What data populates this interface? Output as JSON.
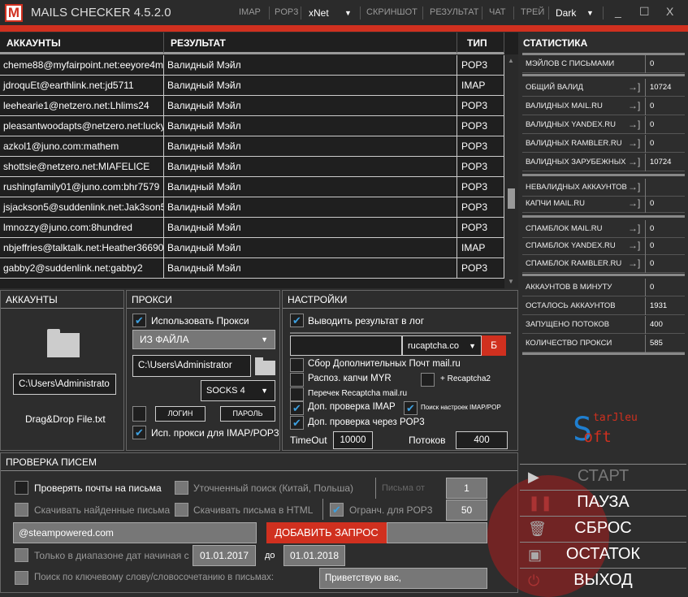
{
  "window": {
    "logo": "M",
    "title": "MAILS CHECKER 4.5.2.0",
    "menu": [
      "IMAP",
      "POP3",
      "xNet",
      "СКРИНШОТ",
      "РЕЗУЛЬТАТ",
      "ЧАТ",
      "ТРЕЙ",
      "Dark"
    ],
    "minimize": "_",
    "maximize": "☐",
    "close": "X"
  },
  "table": {
    "headers": [
      "АККАУНТЫ",
      "РЕЗУЛЬТАТ",
      "ТИП"
    ],
    "rows": [
      [
        "cheme88@myfairpoint.net:eeyore4m",
        "Валидный Мэйл",
        "POP3"
      ],
      [
        "jdroquEt@earthlink.net:jd5711",
        "Валидный Мэйл",
        "IMAP"
      ],
      [
        "leehearie1@netzero.net:Lhlims24",
        "Валидный Мэйл",
        "POP3"
      ],
      [
        "pleasantwoodapts@netzero.net:lucky",
        "Валидный Мэйл",
        "POP3"
      ],
      [
        "azkol1@juno.com:mathem",
        "Валидный Мэйл",
        "POP3"
      ],
      [
        "shottsie@netzero.net:MIAFELICE",
        "Валидный Мэйл",
        "POP3"
      ],
      [
        "rushingfamily01@juno.com:bhr7579",
        "Валидный Мэйл",
        "POP3"
      ],
      [
        "jsjackson5@suddenlink.net:Jak3son5",
        "Валидный Мэйл",
        "POP3"
      ],
      [
        "lmnozzy@juno.com:8hundred",
        "Валидный Мэйл",
        "POP3"
      ],
      [
        "nbjeffries@talktalk.net:Heather36690",
        "Валидный Мэйл",
        "IMAP"
      ],
      [
        "gabby2@suddenlink.net:gabby2",
        "Валидный Мэйл",
        "POP3"
      ]
    ]
  },
  "stats": {
    "title": "СТАТИСТИКА",
    "items": [
      {
        "label": "МЭЙЛОВ С ПИСЬМАМИ",
        "value": "0"
      },
      {
        "label": "ОБЩИЙ ВАЛИД",
        "value": "10724"
      },
      {
        "label": "ВАЛИДНЫХ MAIL.RU",
        "value": "0"
      },
      {
        "label": "ВАЛИДНЫХ YANDEX.RU",
        "value": "0"
      },
      {
        "label": "ВАЛИДНЫХ RAMBLER.RU",
        "value": "0"
      },
      {
        "label": "ВАЛИДНЫХ ЗАРУБЕЖНЫХ",
        "value": "10724"
      },
      {
        "label": "НЕВАЛИДНЫХ АККАУНТОВ",
        "value": ""
      },
      {
        "label": "КАПЧИ MAIL.RU",
        "value": "0"
      },
      {
        "label": "СПАМБЛОК MAIL.RU",
        "value": "0"
      },
      {
        "label": "СПАМБЛОК YANDEX.RU",
        "value": "0"
      },
      {
        "label": "СПАМБЛОК RAMBLER.RU",
        "value": "0"
      },
      {
        "label": "АККАУНТОВ В МИНУТУ",
        "value": "0"
      },
      {
        "label": "ОСТАЛОСЬ АККАУНТОВ",
        "value": "1931"
      },
      {
        "label": "ЗАПУЩЕНО ПОТОКОВ",
        "value": "400"
      },
      {
        "label": "КОЛИЧЕСТВО ПРОКСИ",
        "value": "585"
      }
    ]
  },
  "accounts": {
    "title": "АККАУНТЫ",
    "path": "C:\\Users\\Administrato",
    "file": "Drag&Drop File.txt"
  },
  "proxy": {
    "title": "ПРОКСИ",
    "use_proxy": "Использовать Прокси",
    "source": "ИЗ ФАЙЛА",
    "path": "C:\\Users\\Administrator",
    "type": "SOCKS 4",
    "login": "ЛОГИН",
    "password": "ПАРОЛЬ",
    "imap_pop3": "Исп. прокси для IMAP/POP3"
  },
  "settings": {
    "title": "НАСТРОЙКИ",
    "log": "Выводить результат в лог",
    "captcha_service": "rucaptcha.co",
    "captcha_btn": "Б",
    "collect": "Сбор Дополнительных Почт mail.ru",
    "myr": "Распоз. капчи MYR",
    "recaptcha2": "+ Recaptcha2",
    "recheck": "Перечек Recaptcha mail.ru",
    "imap_check": "Доп. проверка IMAP",
    "imap_search": "Поиск настроек IMAP/POP",
    "pop3_check": "Доп. проверка через POP3",
    "timeout_label": "TimeOut",
    "timeout": "10000",
    "threads_label": "Потоков",
    "threads": "400"
  },
  "mailcheck": {
    "title": "ПРОВЕРКА ПИСЕМ",
    "check": "Проверять почты на письма",
    "refined": "Уточненный поиск (Китай, Польша)",
    "letters_from": "Письма от",
    "from_val": "1",
    "download": "Скачивать найденные письма",
    "html": "Скачивать письма в HTML",
    "limit": "Огранч. для POP3",
    "limit_val": "50",
    "query": "@steampowered.com",
    "add_query": "ДОБАВИТЬ ЗАПРОС",
    "date_range": "Только в диапазоне дат начиная с",
    "date_from": "01.01.2017",
    "to": "до",
    "date_to": "01.01.2018",
    "keyword": "Поиск по ключевому слову/словосочетанию в письмах:",
    "keyword_val": "Приветствую вас,"
  },
  "brand": {
    "line1": "StarJleu",
    "line2": "Soft"
  },
  "actions": {
    "start": "СТАРТ",
    "pause": "ПАУЗА",
    "reset": "СБРОС",
    "rest": "ОСТАТОК",
    "exit": "ВЫХОД"
  },
  "colors": {
    "accent": "#d0301f",
    "check": "#3da0e0"
  }
}
